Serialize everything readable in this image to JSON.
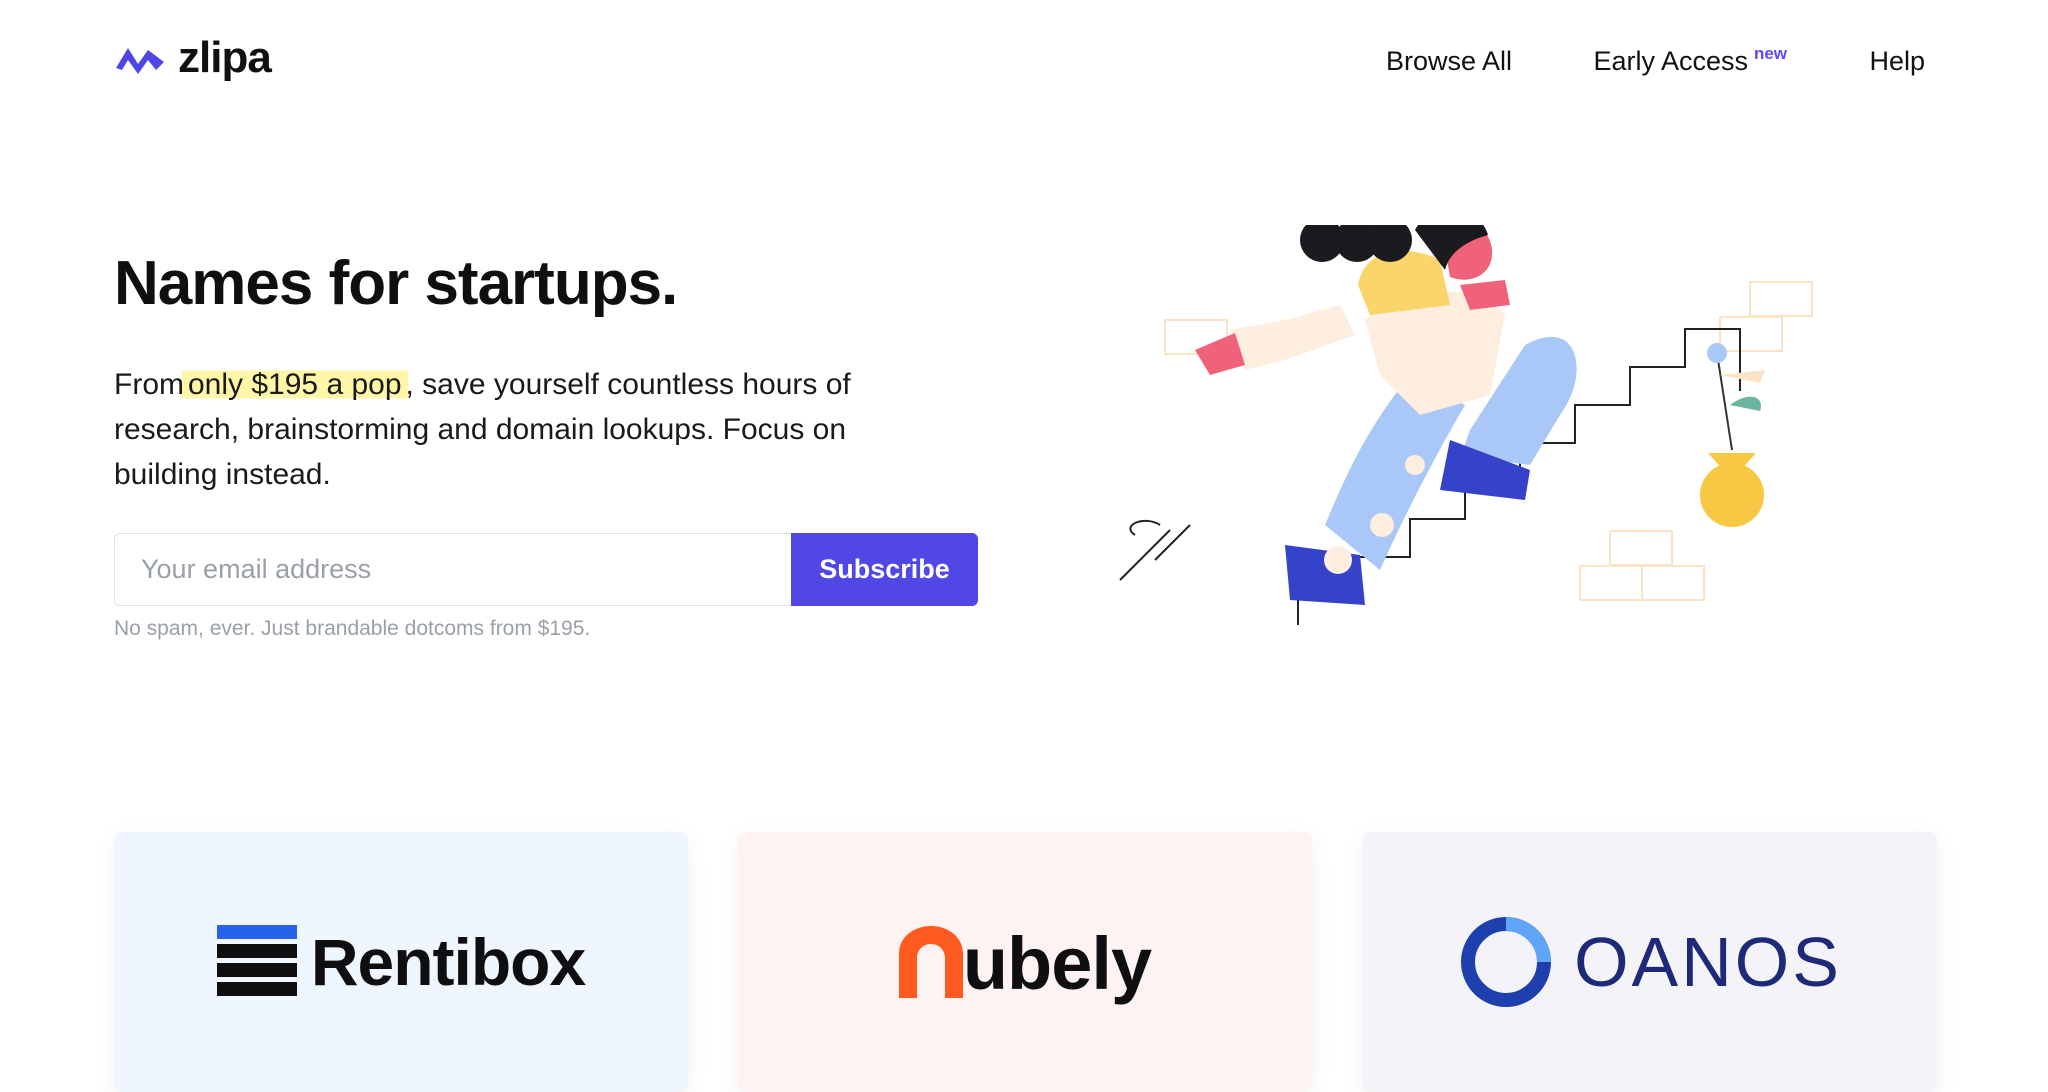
{
  "header": {
    "logo_text": "zlipa",
    "nav": [
      {
        "label": "Browse All"
      },
      {
        "label": "Early Access",
        "badge": "new"
      },
      {
        "label": "Help"
      }
    ]
  },
  "hero": {
    "title": "Names for startups.",
    "lead_before": "From",
    "lead_highlight": "only $195 a pop",
    "lead_after": ", save yourself countless hours of research, brainstorming and domain lookups. Focus on building instead.",
    "email_placeholder": "Your email address",
    "subscribe_label": "Subscribe",
    "note": "No spam, ever. Just brandable dotcoms from $195."
  },
  "cards": [
    {
      "name": "Rentibox",
      "background": "#f0f6fd"
    },
    {
      "name": "ubely",
      "background": "#fdf3f2"
    },
    {
      "name": "OANOS",
      "background": "#f3f3f8"
    }
  ],
  "colors": {
    "accent": "#5147e5",
    "highlight": "#fff6a8",
    "badge": "#5b4bff"
  }
}
